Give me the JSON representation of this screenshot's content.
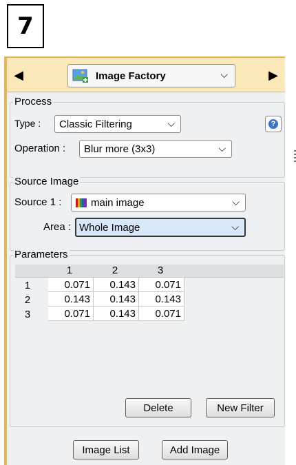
{
  "step_number": "7",
  "topbar": {
    "prev_icon": "triangle-left-icon",
    "next_icon": "triangle-right-icon",
    "app_selector_value": "Image Factory",
    "app_icon": "image-add-icon"
  },
  "process": {
    "legend": "Process",
    "type_label": "Type :",
    "type_value": "Classic Filtering",
    "operation_label": "Operation :",
    "operation_value": "Blur more (3x3)",
    "help_icon": "help-icon"
  },
  "source": {
    "legend": "Source Image",
    "source1_label": "Source 1 :",
    "source1_value": "main image",
    "source1_icon": "color-bars-icon",
    "area_label": "Area :",
    "area_value": "Whole Image"
  },
  "parameters": {
    "legend": "Parameters",
    "columns": [
      "1",
      "2",
      "3"
    ],
    "rows": [
      {
        "label": "1",
        "values": [
          "0.071",
          "0.143",
          "0.071"
        ]
      },
      {
        "label": "2",
        "values": [
          "0.143",
          "0.143",
          "0.143"
        ]
      },
      {
        "label": "3",
        "values": [
          "0.071",
          "0.143",
          "0.071"
        ]
      }
    ],
    "delete_label": "Delete",
    "new_filter_label": "New Filter"
  },
  "footer": {
    "image_list_label": "Image List",
    "add_image_label": "Add Image"
  }
}
